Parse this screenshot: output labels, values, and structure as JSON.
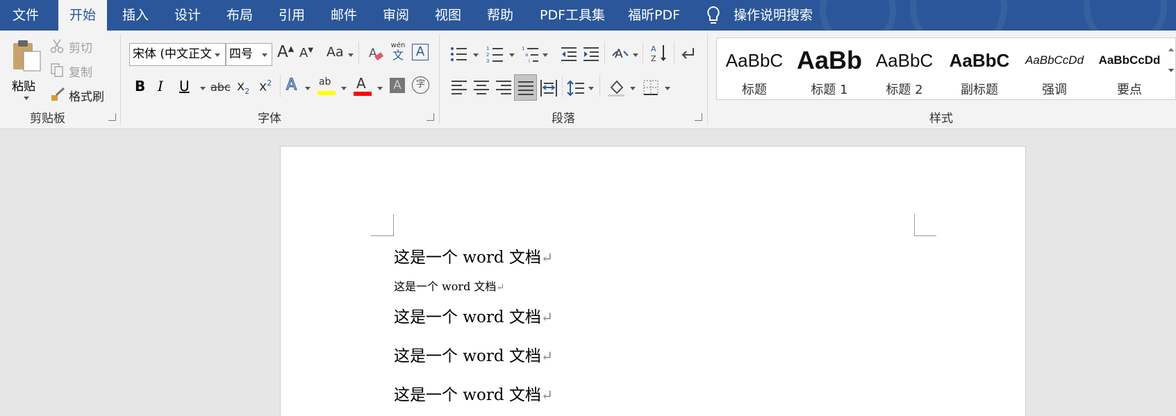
{
  "tabs": {
    "file": "文件",
    "home": "开始",
    "insert": "插入",
    "design": "设计",
    "layout": "布局",
    "references": "引用",
    "mailings": "邮件",
    "review": "审阅",
    "view": "视图",
    "help": "帮助",
    "pdf_tools": "PDF工具集",
    "foxit": "福昕PDF",
    "tell_me": "操作说明搜索"
  },
  "clipboard": {
    "paste": "粘贴",
    "cut": "剪切",
    "copy": "复制",
    "format_painter": "格式刷",
    "label": "剪贴板"
  },
  "font": {
    "name": "宋体 (中文正文",
    "size": "四号",
    "label": "字体",
    "wen_pinyin": "wén",
    "wen_char": "文",
    "bold": "B",
    "italic": "I",
    "underline": "U",
    "strike": "abc",
    "sub": "x",
    "sub2": "2",
    "sup": "x",
    "sup2": "2",
    "aa": "Aa",
    "grow": "A",
    "shrink": "A",
    "border_a": "A",
    "effects": "A",
    "highlight": "ab",
    "font_color": "A",
    "shade": "A",
    "circle": "字"
  },
  "paragraph": {
    "label": "段落"
  },
  "styles": {
    "label": "样式",
    "items": [
      {
        "preview": "AaBbC",
        "name": "标题"
      },
      {
        "preview": "AaBb",
        "name": "标题 1"
      },
      {
        "preview": "AaBbC",
        "name": "标题 2"
      },
      {
        "preview": "AaBbC",
        "name": "副标题"
      },
      {
        "preview": "AaBbCcDd",
        "name": "强调"
      },
      {
        "preview": "AaBbCcDd",
        "name": "要点"
      }
    ]
  },
  "document": {
    "lines": [
      "这是一个 word 文档",
      "这是一个 word 文档",
      "这是一个 word 文档",
      "这是一个 word 文档",
      "这是一个 word 文档"
    ],
    "mark": "↵"
  },
  "colors": {
    "accent": "#2b579a",
    "highlight": "#ffff00",
    "font_color": "#ff0000"
  }
}
